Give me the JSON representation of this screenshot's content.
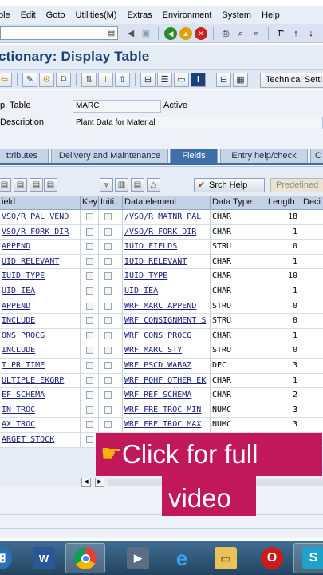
{
  "menu": [
    "ble",
    "Edit",
    "Goto",
    "Utilities(M)",
    "Extras",
    "Environment",
    "System",
    "Help"
  ],
  "title": "ctionary: Display Table",
  "toolbar": {
    "technical_settings": "Technical Setti"
  },
  "fields": {
    "table_label": "p. Table",
    "table_value": "MARC",
    "table_status": "Active",
    "desc_label": "Description",
    "desc_value": "Plant Data for Material"
  },
  "tabs": [
    "ttributes",
    "Delivery and Maintenance",
    "Fields",
    "Entry help/check",
    "C"
  ],
  "active_tab": "Fields",
  "grid_toolbar": {
    "search_help": "Srch Help",
    "predefined": "Predefined"
  },
  "columns": [
    "ield",
    "Key",
    "Initi...",
    "Data element",
    "Data Type",
    "Length",
    "Deci"
  ],
  "rows": [
    {
      "field": "VSO/R PAL VEND",
      "key": false,
      "init": false,
      "element": "/VSO/R MATNR PAL",
      "type": "CHAR",
      "length": "18"
    },
    {
      "field": "VSO/R FORK DIR",
      "key": false,
      "init": false,
      "element": "/VSO/R FORK DIR",
      "type": "CHAR",
      "length": "1"
    },
    {
      "field": "APPEND",
      "key": false,
      "init": false,
      "element": "IUID FIELDS",
      "type": "STRU",
      "length": "0"
    },
    {
      "field": "UID RELEVANT",
      "key": false,
      "init": false,
      "element": "IUID RELEVANT",
      "type": "CHAR",
      "length": "1"
    },
    {
      "field": "IUID TYPE",
      "key": false,
      "init": false,
      "element": "IUID TYPE",
      "type": "CHAR",
      "length": "10"
    },
    {
      "field": "UID IEA",
      "key": false,
      "init": false,
      "element": "UID IEA",
      "type": "CHAR",
      "length": "1"
    },
    {
      "field": "APPEND",
      "key": false,
      "init": false,
      "element": "WRF MARC APPEND",
      "type": "STRU",
      "length": "0"
    },
    {
      "field": "INCLUDE",
      "key": false,
      "init": false,
      "element": "WRF CONSIGNMENT S",
      "type": "STRU",
      "length": "0"
    },
    {
      "field": "ONS PROCG",
      "key": false,
      "init": false,
      "element": "WRF CONS PROCG",
      "type": "CHAR",
      "length": "1"
    },
    {
      "field": "INCLUDE",
      "key": false,
      "init": false,
      "element": "WRF MARC STY",
      "type": "STRU",
      "length": "0"
    },
    {
      "field": "I PR TIME",
      "key": false,
      "init": false,
      "element": "WRF PSCD WABAZ",
      "type": "DEC",
      "length": "3"
    },
    {
      "field": "ULTIPLE EKGRP",
      "key": false,
      "init": false,
      "element": "WRF POHF OTHER EK",
      "type": "CHAR",
      "length": "1"
    },
    {
      "field": "EF SCHEMA",
      "key": false,
      "init": false,
      "element": "WRF REF SCHEMA",
      "type": "CHAR",
      "length": "2"
    },
    {
      "field": "IN TROC",
      "key": false,
      "init": false,
      "element": "WRF FRE TROC MIN",
      "type": "NUMC",
      "length": "3"
    },
    {
      "field": "AX TROC",
      "key": false,
      "init": false,
      "element": "WRF FRE TROC MAX",
      "type": "NUMC",
      "length": "3"
    },
    {
      "field": "ARGET STOCK",
      "key": false,
      "init": false,
      "element": "",
      "type": "",
      "length": ""
    }
  ],
  "overlay": {
    "line1": "Click for full",
    "line2": "video"
  },
  "colors": {
    "overlay": "#c1175b",
    "active_tab": "#3f6ea8",
    "title": "#1b3f78"
  }
}
